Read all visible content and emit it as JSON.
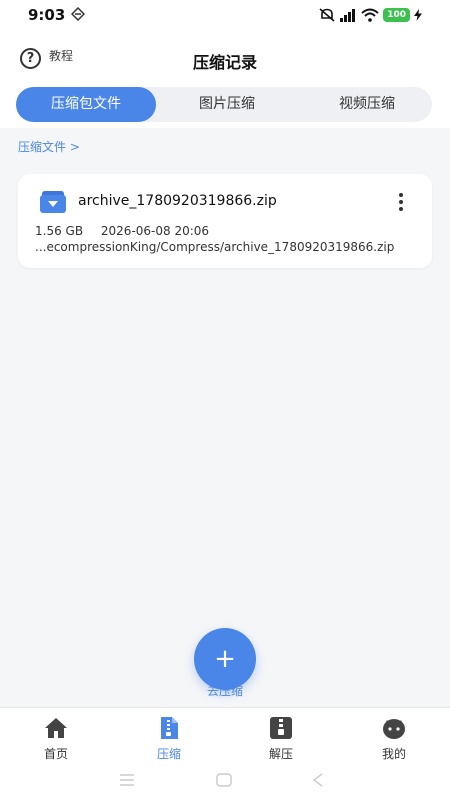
{
  "status_bar": {
    "time": "9:03",
    "battery": "100"
  },
  "header": {
    "help_label": "教程",
    "title": "压缩记录"
  },
  "tabs": [
    {
      "label": "压缩包文件"
    },
    {
      "label": "图片压缩"
    },
    {
      "label": "视频压缩"
    }
  ],
  "breadcrumb": "压缩文件 >",
  "files": [
    {
      "name": "archive_1780920319866.zip",
      "size": "1.56 GB",
      "date": "2026-06-08 20:06",
      "path": "...ecompressionKing/Compress/archive_1780920319866.zip"
    }
  ],
  "fab": {
    "icon": "+",
    "label": "去压缩"
  },
  "bottom_nav": [
    {
      "label": "首页",
      "icon": "home-icon"
    },
    {
      "label": "压缩",
      "icon": "compress-file-icon"
    },
    {
      "label": "解压",
      "icon": "decompress-icon"
    },
    {
      "label": "我的",
      "icon": "profile-icon"
    }
  ],
  "colors": {
    "accent": "#4a86e8",
    "background": "#f5f6f8",
    "battery": "#3cc04e"
  }
}
